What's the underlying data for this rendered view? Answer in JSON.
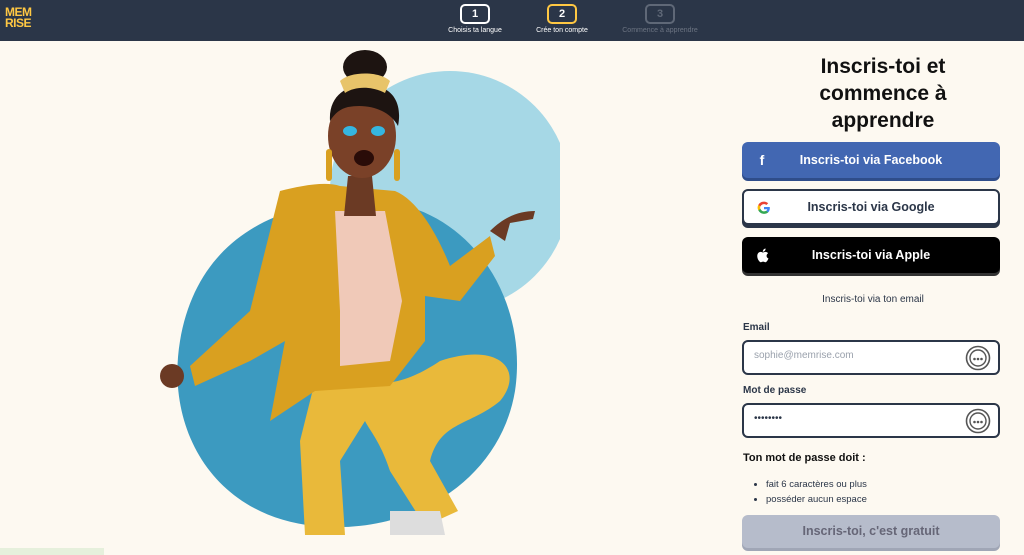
{
  "brand": {
    "logo_line1": "MEM",
    "logo_line2": "RISE",
    "accent": "#ffc843",
    "navy": "#2b3648"
  },
  "steps": [
    {
      "number": "1",
      "label": "Choisis ta langue",
      "state": "done"
    },
    {
      "number": "2",
      "label": "Crée ton compte",
      "state": "active"
    },
    {
      "number": "3",
      "label": "Commence à apprendre",
      "state": "disabled"
    }
  ],
  "form": {
    "title_line1": "Inscris-toi et",
    "title_line2": "commence à",
    "title_line3": "apprendre",
    "facebook_label": "Inscris-toi via Facebook",
    "google_label": "Inscris-toi via Google",
    "apple_label": "Inscris-toi via Apple",
    "email_divider": "Inscris-toi via ton email",
    "email_label": "Email",
    "email_placeholder": "sophie@memrise.com",
    "password_label": "Mot de passe",
    "password_value": "••••••••",
    "rules_title": "Ton mot de passe doit :",
    "rules": [
      "fait 6 caractères ou plus",
      "posséder aucun espace"
    ],
    "submit_label": "Inscris-toi, c'est gratuit"
  },
  "icons": {
    "facebook": "facebook-icon",
    "google": "google-icon",
    "apple": "apple-icon",
    "password_manager": "password-manager-icon"
  }
}
